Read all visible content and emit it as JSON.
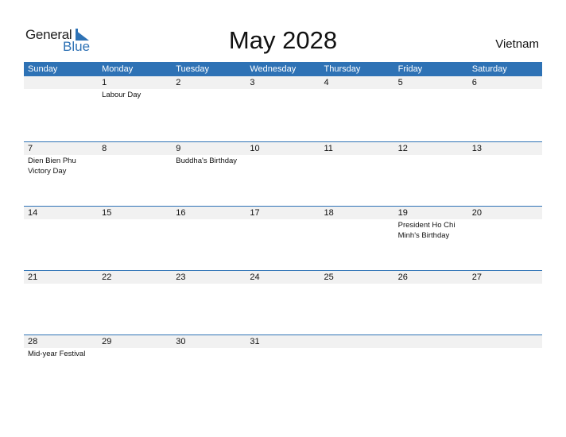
{
  "logo": {
    "word1": "General",
    "word2": "Blue"
  },
  "title": "May 2028",
  "country": "Vietnam",
  "colors": {
    "accent": "#2E72B5",
    "date_strip": "#F1F1F1"
  },
  "weekdays": [
    "Sunday",
    "Monday",
    "Tuesday",
    "Wednesday",
    "Thursday",
    "Friday",
    "Saturday"
  ],
  "weeks": [
    {
      "days": [
        {
          "num": "",
          "event": ""
        },
        {
          "num": "1",
          "event": "Labour Day"
        },
        {
          "num": "2",
          "event": ""
        },
        {
          "num": "3",
          "event": ""
        },
        {
          "num": "4",
          "event": ""
        },
        {
          "num": "5",
          "event": ""
        },
        {
          "num": "6",
          "event": ""
        }
      ]
    },
    {
      "days": [
        {
          "num": "7",
          "event": "Dien Bien Phu Victory Day"
        },
        {
          "num": "8",
          "event": ""
        },
        {
          "num": "9",
          "event": "Buddha's Birthday"
        },
        {
          "num": "10",
          "event": ""
        },
        {
          "num": "11",
          "event": ""
        },
        {
          "num": "12",
          "event": ""
        },
        {
          "num": "13",
          "event": ""
        }
      ]
    },
    {
      "days": [
        {
          "num": "14",
          "event": ""
        },
        {
          "num": "15",
          "event": ""
        },
        {
          "num": "16",
          "event": ""
        },
        {
          "num": "17",
          "event": ""
        },
        {
          "num": "18",
          "event": ""
        },
        {
          "num": "19",
          "event": "President Ho Chi Minh's Birthday"
        },
        {
          "num": "20",
          "event": ""
        }
      ]
    },
    {
      "days": [
        {
          "num": "21",
          "event": ""
        },
        {
          "num": "22",
          "event": ""
        },
        {
          "num": "23",
          "event": ""
        },
        {
          "num": "24",
          "event": ""
        },
        {
          "num": "25",
          "event": ""
        },
        {
          "num": "26",
          "event": ""
        },
        {
          "num": "27",
          "event": ""
        }
      ]
    },
    {
      "days": [
        {
          "num": "28",
          "event": "Mid-year Festival"
        },
        {
          "num": "29",
          "event": ""
        },
        {
          "num": "30",
          "event": ""
        },
        {
          "num": "31",
          "event": ""
        },
        {
          "num": "",
          "event": ""
        },
        {
          "num": "",
          "event": ""
        },
        {
          "num": "",
          "event": ""
        }
      ]
    }
  ]
}
